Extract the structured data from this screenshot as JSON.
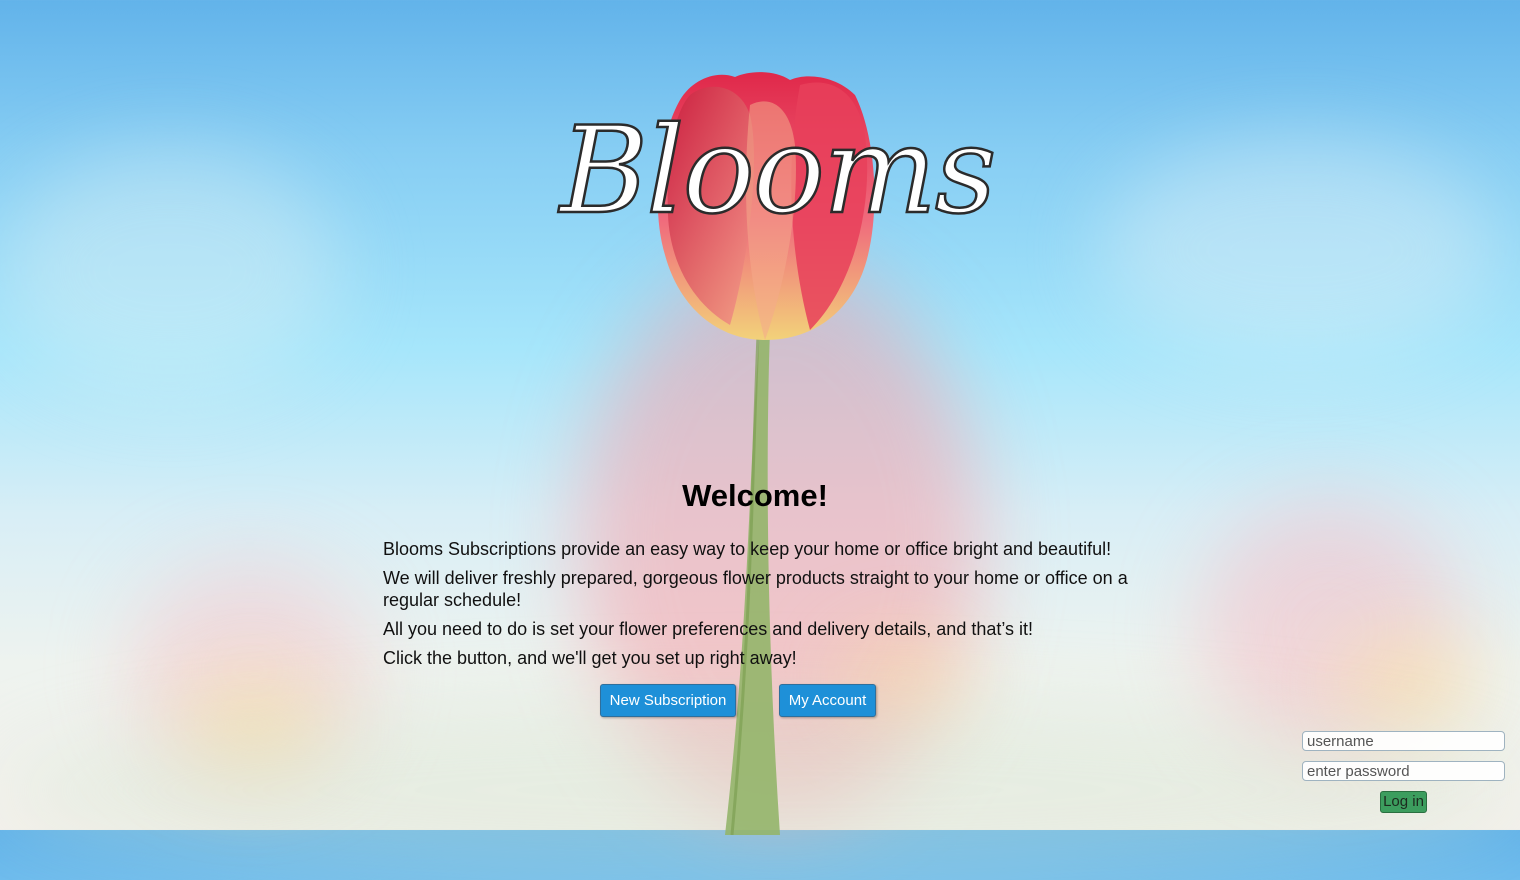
{
  "brand": {
    "logo_text": "Blooms"
  },
  "main": {
    "heading": "Welcome!",
    "paragraphs": [
      "Blooms Subscriptions provide an easy way to keep your home or office bright and beautiful!",
      "We will deliver freshly prepared, gorgeous flower products straight to your home or office on a regular schedule!",
      "All you need to do is set your flower preferences and delivery details, and that’s it!",
      "Click the button, and we'll get you set up right away!"
    ],
    "buttons": {
      "new_subscription": "New Subscription",
      "my_account": "My Account"
    }
  },
  "login": {
    "username_placeholder": "username",
    "password_placeholder": "enter password",
    "submit_label": "Log in"
  },
  "colors": {
    "button_blue": "#1e90d8",
    "login_green": "#3c9d5e",
    "tulip_red": "#e43a52",
    "sky_blue": "#62b3ea"
  }
}
